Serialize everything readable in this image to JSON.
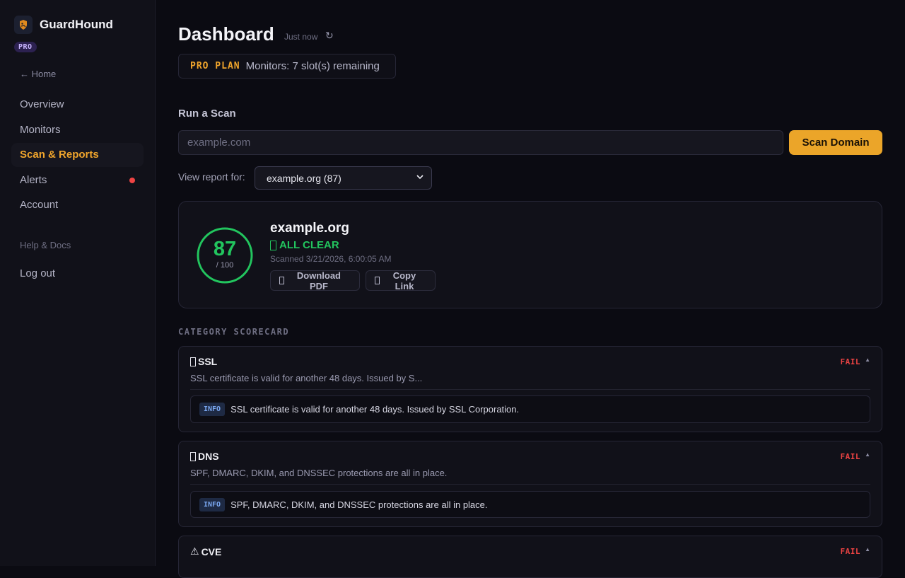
{
  "app": {
    "name": "GuardHound",
    "plan_badge": "PRO",
    "home_link": "← Home"
  },
  "sidebar": {
    "items": [
      {
        "label": "Overview",
        "active": false
      },
      {
        "label": "Monitors",
        "active": false
      },
      {
        "label": "Scan & Reports",
        "active": true
      },
      {
        "label": "Alerts",
        "active": false,
        "has_notification_dot": true
      },
      {
        "label": "Account",
        "active": false
      }
    ],
    "help_link": "Help & Docs",
    "logout": "Log out"
  },
  "header": {
    "title": "Dashboard",
    "updated": "Just now",
    "refresh_icon": "↻"
  },
  "plan": {
    "label": "PRO PLAN",
    "text": "Monitors: 7 slot(s) remaining"
  },
  "scan": {
    "section_title": "Run a Scan",
    "placeholder": "example.com",
    "value": "",
    "button_label": "Scan Domain",
    "view_label": "View report for:",
    "selected_report": "example.org (87)"
  },
  "report": {
    "score": "87",
    "score_max": "/ 100",
    "domain": "example.org",
    "status": "ALL CLEAR",
    "scanned_at": "Scanned 3/21/2026, 6:00:05 AM",
    "download_label": "Download PDF",
    "copy_label": "Copy Link"
  },
  "scorecard": {
    "title": "CATEGORY SCORECARD",
    "categories": [
      {
        "name": "SSL",
        "icon": "glyph-box",
        "status": "FAIL",
        "summary": "SSL certificate is valid for another 48 days. Issued by S...",
        "finding_level": "INFO",
        "finding_text": "SSL certificate is valid for another 48 days. Issued by SSL Corporation."
      },
      {
        "name": "DNS",
        "icon": "glyph-box",
        "status": "FAIL",
        "summary": "SPF, DMARC, DKIM, and DNSSEC protections are all in place.",
        "finding_level": "INFO",
        "finding_text": "SPF, DMARC, DKIM, and DNSSEC protections are all in place."
      },
      {
        "name": "CVE",
        "icon": "⚠",
        "status": "FAIL"
      }
    ]
  },
  "colors": {
    "accent": "#f0a52c",
    "success": "#22c55e",
    "danger": "#ef4444",
    "background": "#0b0b12",
    "sidebar": "#111119"
  }
}
